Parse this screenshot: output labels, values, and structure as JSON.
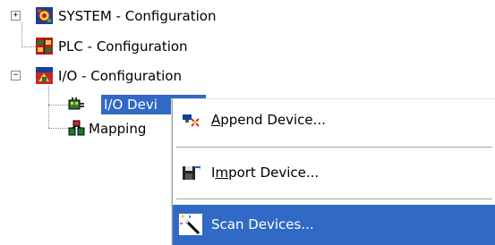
{
  "tree": {
    "items": [
      {
        "label": "SYSTEM - Configuration",
        "icon": "system-config-icon",
        "expander": "+"
      },
      {
        "label": "PLC - Configuration",
        "icon": "plc-config-icon"
      },
      {
        "label": "I/O - Configuration",
        "icon": "io-config-icon",
        "expander": "−"
      },
      {
        "label": "I/O Devi",
        "icon": "io-devices-icon",
        "selected": true
      },
      {
        "label": "Mapping",
        "icon": "mappings-icon"
      }
    ]
  },
  "context_menu": {
    "items": [
      {
        "label_pre": "",
        "mnemonic": "A",
        "label_post": "ppend Device...",
        "icon": "append-device-icon"
      },
      {
        "label_pre": "I",
        "mnemonic": "m",
        "label_post": "port Device...",
        "icon": "import-device-icon"
      },
      {
        "label_pre": "",
        "mnemonic": "",
        "label_post": "Scan Devices...",
        "icon": "scan-devices-wand-icon",
        "highlighted": true
      }
    ]
  },
  "colors": {
    "selection": "#316ac5",
    "selection_text": "#ffffff",
    "tree_lines": "#8a8a8a"
  }
}
